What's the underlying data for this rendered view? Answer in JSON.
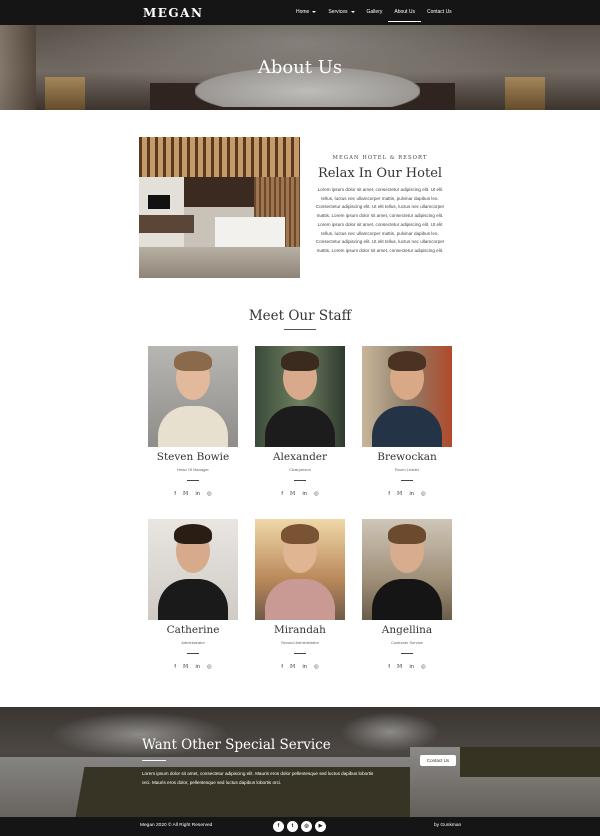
{
  "brand": "MEGAN",
  "nav": {
    "items": [
      {
        "label": "Home",
        "dropdown": true
      },
      {
        "label": "Services",
        "dropdown": true
      },
      {
        "label": "Gallery",
        "dropdown": false
      },
      {
        "label": "About Us",
        "dropdown": false,
        "active": true
      },
      {
        "label": "Contact Us",
        "dropdown": false
      }
    ]
  },
  "hero": {
    "title": "About Us"
  },
  "about": {
    "eyebrow": "MEGAN HOTEL & RESORT",
    "title": "Relax In Our Hotel",
    "paragraphs": [
      "Lorem ipsum dolor sit amet, consectetur adipiscing elit. Ut elit tellus, luctus nec ullamcorper mattis, pulvinar dapibus leo. Consectetur adipiscing elit. Ut elit tellus, luctus nec ullamcorper mattis. Lorem ipsum dolor sit amet, consectetur adipiscing elit.",
      "Lorem ipsum dolor sit amet, consectetur adipiscing elit. Ut elit tellus, luctus nec ullamcorper mattis, pulvinar dapibus leo. Consectetur adipiscing elit. Ut elit tellus, luctus nec ullamcorper mattis. Lorem ipsum dolor sit amet, consectetur adipiscing elit."
    ]
  },
  "staff": {
    "title": "Meet Our Staff",
    "members": [
      {
        "name": "Steven Bowie",
        "role": "Head Of Manager"
      },
      {
        "name": "Alexander",
        "role": "Chairperson"
      },
      {
        "name": "Brewockan",
        "role": "Room Leader"
      },
      {
        "name": "Catherine",
        "role": "Administrator"
      },
      {
        "name": "Mirandah",
        "role": "Second Administrator"
      },
      {
        "name": "Angellina",
        "role": "Costumer Service"
      }
    ],
    "social_icons": [
      "facebook-icon",
      "twitter-icon",
      "linkedin-icon",
      "instagram-icon"
    ]
  },
  "service": {
    "title": "Want Other Special Service",
    "text": "Lorem ipsum dolor sit amet, consectetur adipiscing elit. Mauris eros dolor pellentesque sed luctus dapibus lobortis orci. Mauris eros dolor, pellentesque sed luctus dapibus lobortis orci.",
    "button": "Contact Us"
  },
  "footer": {
    "copyright": "Megan 2020 © All Right Reserved",
    "credit": "by Gunkman",
    "social_icons": [
      "facebook-icon",
      "twitter-icon",
      "instagram-icon",
      "youtube-icon"
    ]
  },
  "colors": {
    "dark": "#151515",
    "text": "#333333"
  }
}
